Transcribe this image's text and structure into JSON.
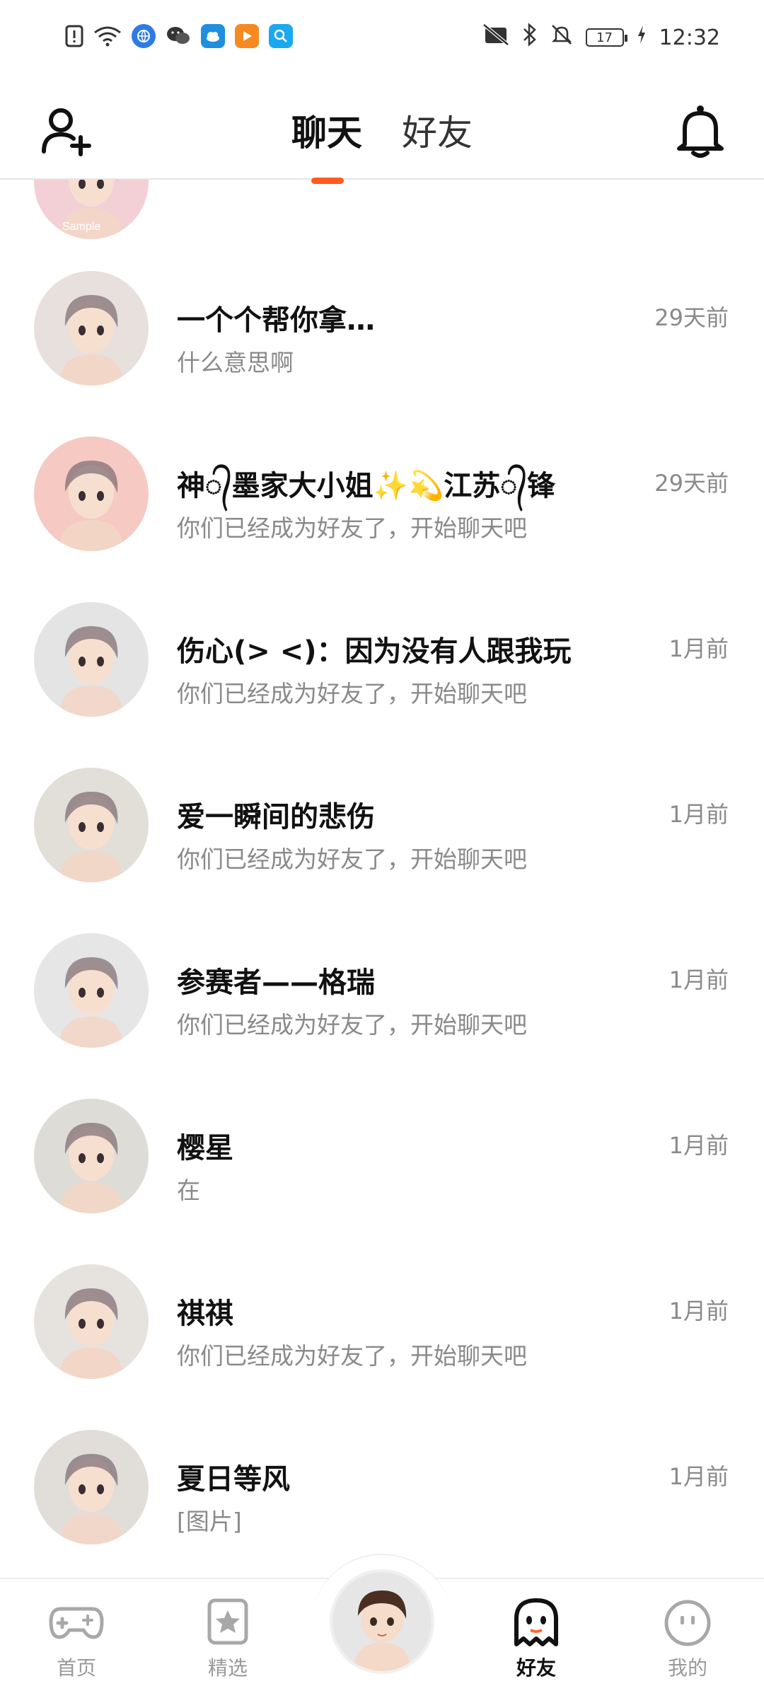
{
  "status_bar": {
    "time": "12:32",
    "battery": "17"
  },
  "header": {
    "tabs": [
      {
        "label": "聊天",
        "active": true
      },
      {
        "label": "好友",
        "active": false
      }
    ]
  },
  "chats": [
    {
      "name": "",
      "preview": "",
      "time": "",
      "avatar_color": "#f3cfd6",
      "avatar_label": "Sample"
    },
    {
      "name": "一个个帮你拿…",
      "preview": "什么意思啊",
      "time": "29天前",
      "avatar_color": "#e8e0dc",
      "avatar_label": ""
    },
    {
      "name": "神᭄墨家大小姐✨💫江苏᭄锋",
      "preview": "你们已经成为好友了，开始聊天吧",
      "time": "29天前",
      "avatar_color": "#f6c9c3",
      "avatar_label": ""
    },
    {
      "name": "伤心(>  <)：因为没有人跟我玩",
      "preview": "你们已经成为好友了，开始聊天吧",
      "time": "1月前",
      "avatar_color": "#e4e4e4",
      "avatar_label": ""
    },
    {
      "name": "爱一瞬间的悲伤",
      "preview": "你们已经成为好友了，开始聊天吧",
      "time": "1月前",
      "avatar_color": "#e2ded8",
      "avatar_label": ""
    },
    {
      "name": "参赛者——格瑞",
      "preview": "你们已经成为好友了，开始聊天吧",
      "time": "1月前",
      "avatar_color": "#e6e6e6",
      "avatar_label": ""
    },
    {
      "name": "樱星",
      "preview": "在",
      "time": "1月前",
      "avatar_color": "#dedcd6",
      "avatar_label": ""
    },
    {
      "name": "祺祺",
      "preview": "你们已经成为好友了，开始聊天吧",
      "time": "1月前",
      "avatar_color": "#e6e2de",
      "avatar_label": ""
    },
    {
      "name": "夏日等风",
      "preview": "[图片]",
      "time": "1月前",
      "avatar_color": "#e1deda",
      "avatar_label": ""
    }
  ],
  "bottom_nav": [
    {
      "label": "首页",
      "icon": "gamepad-icon"
    },
    {
      "label": "精选",
      "icon": "star-icon"
    },
    {
      "label": "好友",
      "icon": "ghost-icon",
      "active": true
    },
    {
      "label": "我的",
      "icon": "smiley-icon"
    }
  ],
  "colors": {
    "accent": "#ff5a1f",
    "secondary_text": "#8a8a8a"
  }
}
